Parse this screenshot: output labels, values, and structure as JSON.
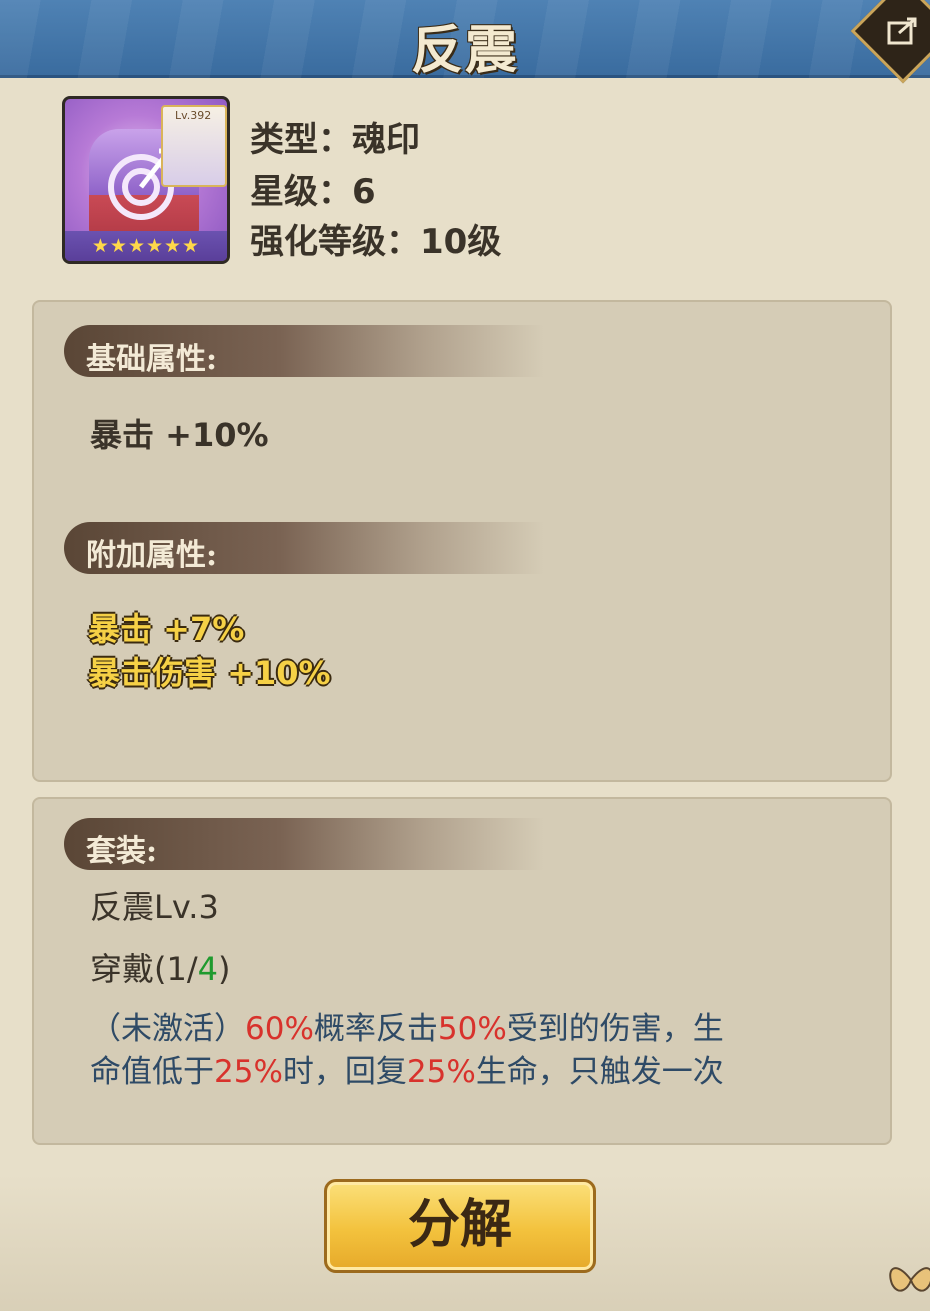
{
  "header": {
    "title": "反震"
  },
  "item": {
    "level_badge": "Lv.392",
    "stars": "★★★★★★",
    "type_line": "类型：魂印",
    "star_line": "星级：6",
    "enhance_line": "强化等级：10级"
  },
  "base_attributes": {
    "title": "基础属性:",
    "stats": [
      "暴击  +10%"
    ]
  },
  "extra_attributes": {
    "title": "附加属性:",
    "stats": [
      "暴击  +7%",
      "暴击伤害  +10%"
    ]
  },
  "set": {
    "title": "套装:",
    "name": "反震Lv.3",
    "wear_prefix": "穿戴(1/",
    "wear_count": "4",
    "wear_suffix": ")",
    "desc": {
      "p1": "（未激活）",
      "v1": "60%",
      "p2": "概率反击",
      "v2": "50%",
      "p3": "受到的伤害，生",
      "p4": "命值低于",
      "v3": "25%",
      "p5": "时，回复",
      "v4": "25%",
      "p6": "生命，只触发一次"
    }
  },
  "actions": {
    "decompose_label": "分解"
  },
  "icons": [
    "share-icon",
    "soul-seal-icon",
    "butterfly-icon"
  ],
  "colors": {
    "header": "#3f72a6",
    "panel": "#d5ccb6",
    "gold_text": "#f6d146",
    "red_value": "#d8322c",
    "green_value": "#1f9a2e"
  }
}
